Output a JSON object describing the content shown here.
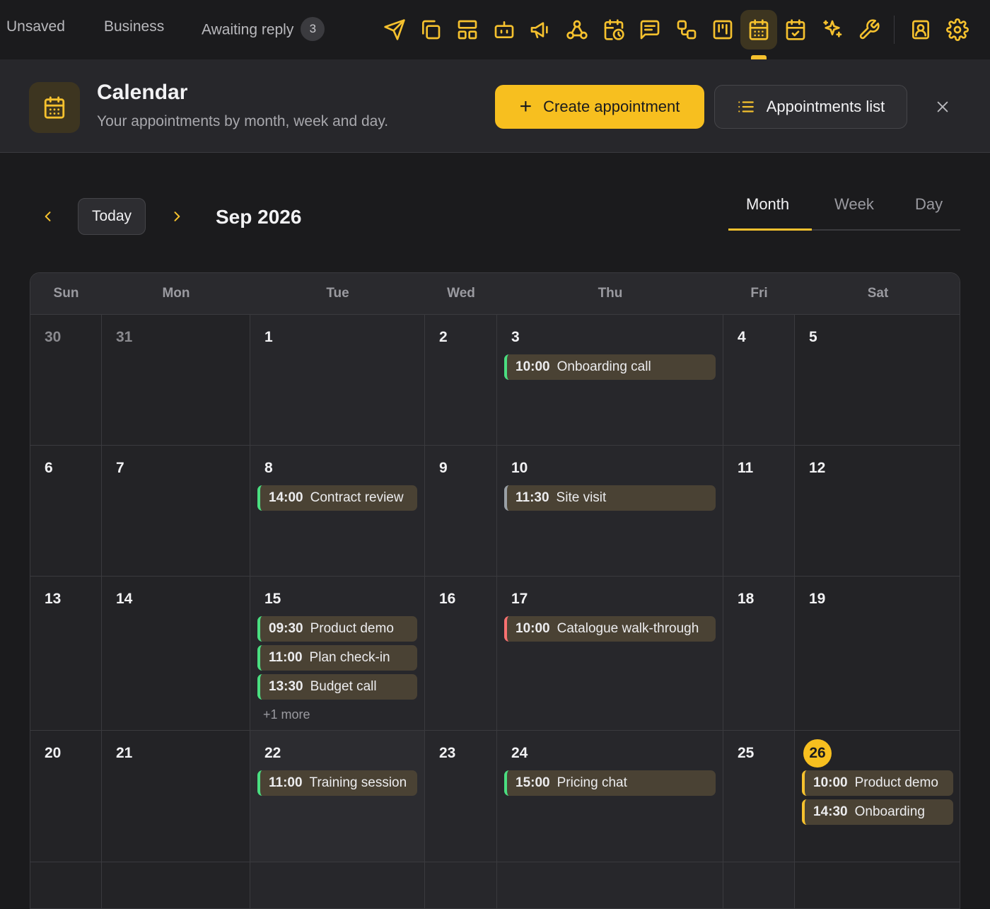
{
  "topbar": {
    "tabs": [
      "Unsaved",
      "Business",
      "Awaiting reply"
    ],
    "awaiting_count": "3",
    "tools": [
      "send-icon",
      "copy-icon",
      "layout-icon",
      "bot-icon",
      "megaphone-icon",
      "webhook-icon",
      "calendar-clock-icon",
      "message-icon",
      "workflow-icon",
      "kanban-icon",
      "calendar-icon",
      "calendar-check-icon",
      "sparkles-icon",
      "wrench-icon",
      "contact-icon",
      "settings-icon"
    ],
    "active_tool": "calendar-icon"
  },
  "header": {
    "title": "Calendar",
    "subtitle": "Your appointments by month, week and day.",
    "create_label": "Create appointment",
    "list_label": "Appointments list"
  },
  "nav": {
    "today_label": "Today",
    "month_label": "Sep 2026",
    "views": [
      "Month",
      "Week",
      "Day"
    ],
    "active_view": "Month"
  },
  "calendar": {
    "weekdays": [
      "Sun",
      "Mon",
      "Tue",
      "Wed",
      "Thu",
      "Fri",
      "Sat"
    ],
    "weeks": [
      [
        {
          "d": "30",
          "muted": true
        },
        {
          "d": "31",
          "muted": true
        },
        {
          "d": "1"
        },
        {
          "d": "2"
        },
        {
          "d": "3",
          "events": [
            {
              "time": "10:00",
              "title": "Onboarding call",
              "color": "green"
            }
          ]
        },
        {
          "d": "4"
        },
        {
          "d": "5"
        }
      ],
      [
        {
          "d": "6"
        },
        {
          "d": "7"
        },
        {
          "d": "8",
          "events": [
            {
              "time": "14:00",
              "title": "Contract review",
              "color": "green"
            }
          ]
        },
        {
          "d": "9"
        },
        {
          "d": "10",
          "events": [
            {
              "time": "11:30",
              "title": "Site visit",
              "color": "gray"
            }
          ]
        },
        {
          "d": "11"
        },
        {
          "d": "12"
        }
      ],
      [
        {
          "d": "13"
        },
        {
          "d": "14"
        },
        {
          "d": "15",
          "events": [
            {
              "time": "09:30",
              "title": "Product demo",
              "color": "green"
            },
            {
              "time": "11:00",
              "title": "Plan check-in",
              "color": "green"
            },
            {
              "time": "13:30",
              "title": "Budget call",
              "color": "green"
            }
          ],
          "more": "+1 more"
        },
        {
          "d": "16"
        },
        {
          "d": "17",
          "events": [
            {
              "time": "10:00",
              "title": "Catalogue walk-through",
              "color": "red"
            }
          ]
        },
        {
          "d": "18"
        },
        {
          "d": "19"
        }
      ],
      [
        {
          "d": "20"
        },
        {
          "d": "21"
        },
        {
          "d": "22",
          "events": [
            {
              "time": "11:00",
              "title": "Training session",
              "color": "green"
            }
          ]
        },
        {
          "d": "23"
        },
        {
          "d": "24",
          "events": [
            {
              "time": "15:00",
              "title": "Pricing chat",
              "color": "green"
            }
          ]
        },
        {
          "d": "25"
        },
        {
          "d": "26",
          "today": true,
          "events": [
            {
              "time": "10:00",
              "title": "Product demo",
              "color": "gold"
            },
            {
              "time": "14:30",
              "title": "Onboarding",
              "color": "gold"
            }
          ]
        }
      ],
      [
        {
          "d": ""
        },
        {
          "d": ""
        },
        {
          "d": ""
        },
        {
          "d": ""
        },
        {
          "d": ""
        },
        {
          "d": ""
        },
        {
          "d": ""
        }
      ]
    ]
  },
  "colors": {
    "accent": "#f7bf1f",
    "green": "#4ade80",
    "gray": "#9aa0a6",
    "red": "#f87171",
    "event_bg": "#4a4234"
  }
}
